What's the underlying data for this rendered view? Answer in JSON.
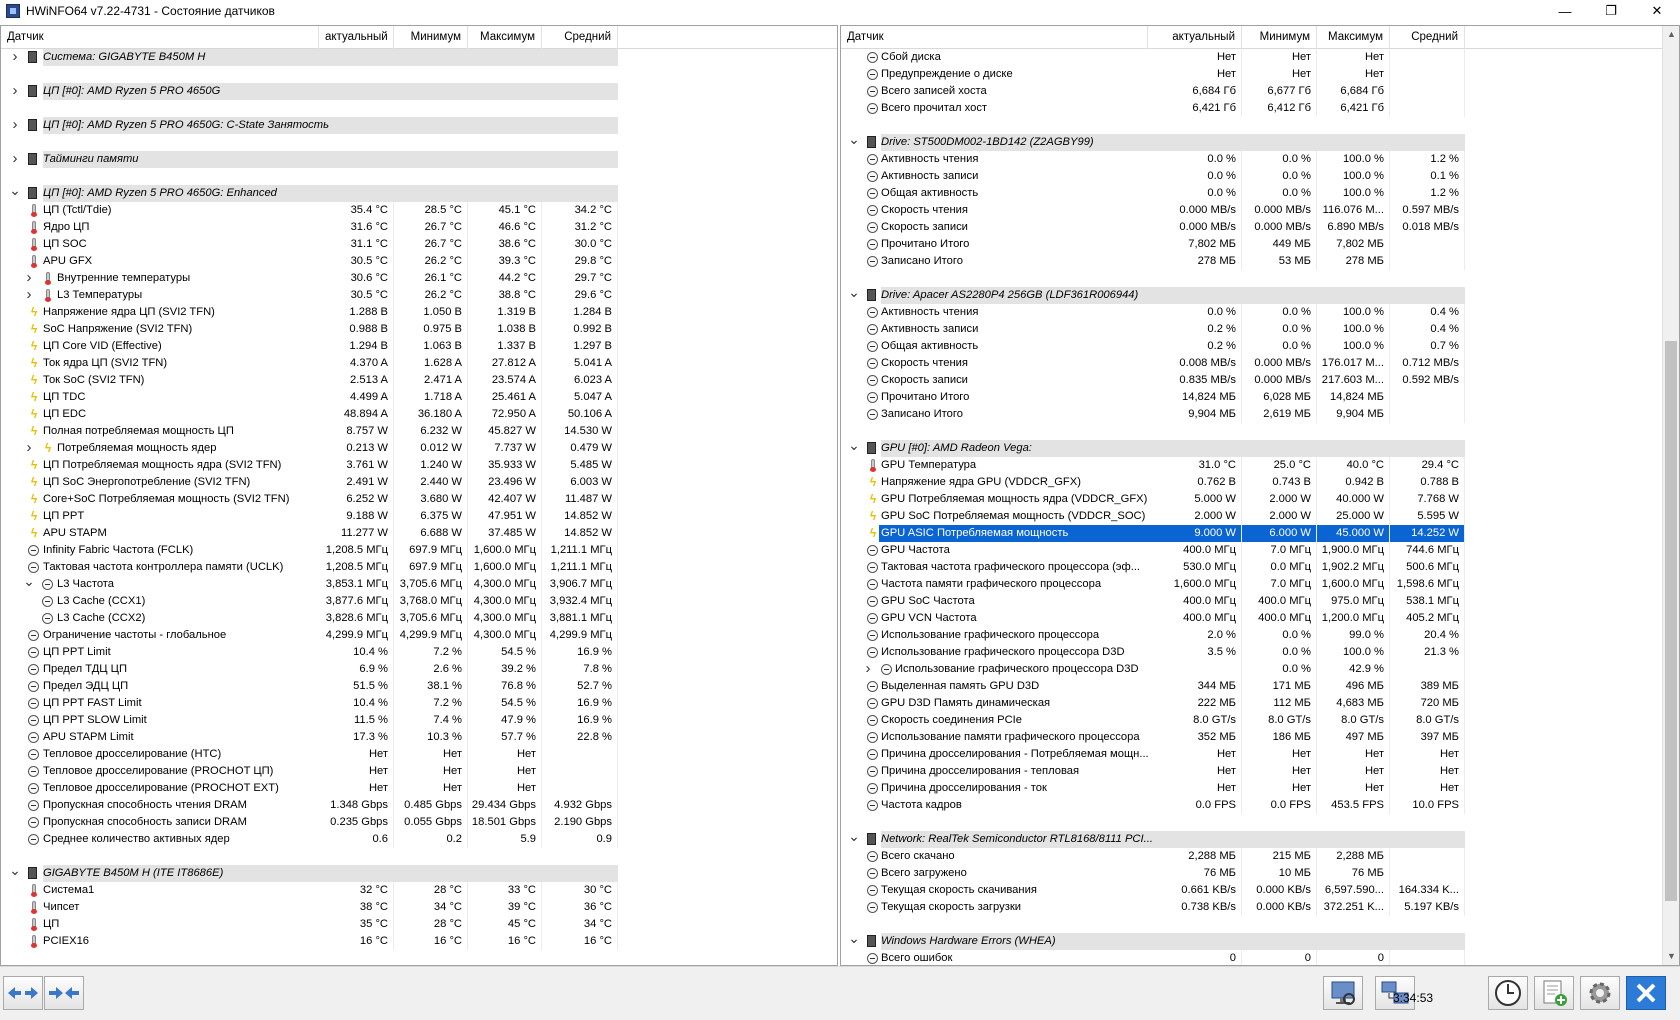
{
  "window": {
    "title": "HWiNFO64 v7.22-4731 - Состояние датчиков",
    "minimize": "—",
    "maximize": "❐",
    "close": "✕"
  },
  "headers": {
    "sensor": "Датчик",
    "current": "актуальный",
    "min": "Минимум",
    "max": "Максимум",
    "avg": "Средний"
  },
  "left_rows": [
    {
      "t": "group",
      "exp": ">",
      "icon": "chip",
      "name": "Система: GIGABYTE B450M H"
    },
    {
      "t": "blank"
    },
    {
      "t": "group",
      "exp": ">",
      "icon": "chip",
      "name": "ЦП [#0]: AMD Ryzen 5 PRO 4650G"
    },
    {
      "t": "blank"
    },
    {
      "t": "group",
      "exp": ">",
      "icon": "chip",
      "name": "ЦП [#0]: AMD Ryzen 5 PRO 4650G: C-State Занятость"
    },
    {
      "t": "blank"
    },
    {
      "t": "group",
      "exp": ">",
      "icon": "chip",
      "name": "Тайминги памяти"
    },
    {
      "t": "blank"
    },
    {
      "t": "group",
      "exp": "v",
      "icon": "chip",
      "name": "ЦП [#0]: AMD Ryzen 5 PRO 4650G: Enhanced"
    },
    {
      "icon": "therm",
      "name": "ЦП (Tctl/Tdie)",
      "v": [
        "35.4 °C",
        "28.5 °C",
        "45.1 °C",
        "34.2 °C"
      ]
    },
    {
      "icon": "therm",
      "name": "Ядро ЦП",
      "v": [
        "31.6 °C",
        "26.7 °C",
        "46.6 °C",
        "31.2 °C"
      ]
    },
    {
      "icon": "therm",
      "name": "ЦП SOC",
      "v": [
        "31.1 °C",
        "26.7 °C",
        "38.6 °C",
        "30.0 °C"
      ]
    },
    {
      "icon": "therm",
      "name": "APU GFX",
      "v": [
        "30.5 °C",
        "26.2 °C",
        "39.3 °C",
        "29.8 °C"
      ]
    },
    {
      "icon": "therm",
      "sub": 1,
      "exp": ">",
      "name": "Внутренние температуры",
      "v": [
        "30.6 °C",
        "26.1 °C",
        "44.2 °C",
        "29.7 °C"
      ]
    },
    {
      "icon": "therm",
      "sub": 1,
      "exp": ">",
      "name": "L3 Температуры",
      "v": [
        "30.5 °C",
        "26.2 °C",
        "38.8 °C",
        "29.6 °C"
      ]
    },
    {
      "icon": "bolt",
      "name": "Напряжение ядра ЦП (SVI2 TFN)",
      "v": [
        "1.288 В",
        "1.050 В",
        "1.319 В",
        "1.284 В"
      ]
    },
    {
      "icon": "bolt",
      "name": "SoC Напряжение (SVI2 TFN)",
      "v": [
        "0.988 В",
        "0.975 В",
        "1.038 В",
        "0.992 В"
      ]
    },
    {
      "icon": "bolt",
      "name": "ЦП Core VID (Effective)",
      "v": [
        "1.294 В",
        "1.063 В",
        "1.337 В",
        "1.297 В"
      ]
    },
    {
      "icon": "bolt",
      "name": "Ток ядра ЦП (SVI2 TFN)",
      "v": [
        "4.370 A",
        "1.628 A",
        "27.812 A",
        "5.041 A"
      ]
    },
    {
      "icon": "bolt",
      "name": "Ток SoC (SVI2 TFN)",
      "v": [
        "2.513 A",
        "2.471 A",
        "23.574 A",
        "6.023 A"
      ]
    },
    {
      "icon": "bolt",
      "name": "ЦП TDC",
      "v": [
        "4.499 A",
        "1.718 A",
        "25.461 A",
        "5.047 A"
      ]
    },
    {
      "icon": "bolt",
      "name": "ЦП EDC",
      "v": [
        "48.894 A",
        "36.180 A",
        "72.950 A",
        "50.106 A"
      ]
    },
    {
      "icon": "bolt",
      "name": "Полная потребляемая мощность ЦП",
      "v": [
        "8.757 W",
        "6.232 W",
        "45.827 W",
        "14.530 W"
      ]
    },
    {
      "icon": "bolt",
      "sub": 1,
      "exp": ">",
      "name": "Потребляемая мощность ядер",
      "v": [
        "0.213 W",
        "0.012 W",
        "7.737 W",
        "0.479 W"
      ]
    },
    {
      "icon": "bolt",
      "name": "ЦП Потребляемая мощность ядра (SVI2 TFN)",
      "v": [
        "3.761 W",
        "1.240 W",
        "35.933 W",
        "5.485 W"
      ]
    },
    {
      "icon": "bolt",
      "name": "ЦП SoC Энергопотребление (SVI2 TFN)",
      "v": [
        "2.491 W",
        "2.440 W",
        "23.496 W",
        "6.003 W"
      ]
    },
    {
      "icon": "bolt",
      "name": "Core+SoC Потребляемая мощность (SVI2 TFN)",
      "v": [
        "6.252 W",
        "3.680 W",
        "42.407 W",
        "11.487 W"
      ]
    },
    {
      "icon": "bolt",
      "name": "ЦП PPT",
      "v": [
        "9.188 W",
        "6.375 W",
        "47.951 W",
        "14.852 W"
      ]
    },
    {
      "icon": "bolt",
      "name": "APU STAPM",
      "v": [
        "11.277 W",
        "6.688 W",
        "37.485 W",
        "14.852 W"
      ]
    },
    {
      "icon": "clock",
      "name": "Infinity Fabric Частота (FCLK)",
      "v": [
        "1,208.5 МГц",
        "697.9 МГц",
        "1,600.0 МГц",
        "1,211.1 МГц"
      ]
    },
    {
      "icon": "clock",
      "name": "Тактовая частота контроллера памяти (UCLK)",
      "v": [
        "1,208.5 МГц",
        "697.9 МГц",
        "1,600.0 МГц",
        "1,211.1 МГц"
      ]
    },
    {
      "icon": "clock",
      "sub": 1,
      "exp": "v",
      "name": "L3 Частота",
      "v": [
        "3,853.1 МГц",
        "3,705.6 МГц",
        "4,300.0 МГц",
        "3,906.7 МГц"
      ]
    },
    {
      "icon": "clock",
      "sub": 1,
      "name": "L3 Cache (CCX1)",
      "v": [
        "3,877.6 МГц",
        "3,768.0 МГц",
        "4,300.0 МГц",
        "3,932.4 МГц"
      ]
    },
    {
      "icon": "clock",
      "sub": 1,
      "name": "L3 Cache (CCX2)",
      "v": [
        "3,828.6 МГц",
        "3,705.6 МГц",
        "4,300.0 МГц",
        "3,881.1 МГц"
      ]
    },
    {
      "icon": "clock",
      "name": "Ограничение частоты - глобальное",
      "v": [
        "4,299.9 МГц",
        "4,299.9 МГц",
        "4,300.0 МГц",
        "4,299.9 МГц"
      ]
    },
    {
      "icon": "clock",
      "name": "ЦП PPT Limit",
      "v": [
        "10.4 %",
        "7.2 %",
        "54.5 %",
        "16.9 %"
      ]
    },
    {
      "icon": "clock",
      "name": "Предел ТДЦ ЦП",
      "v": [
        "6.9 %",
        "2.6 %",
        "39.2 %",
        "7.8 %"
      ]
    },
    {
      "icon": "clock",
      "name": "Предел ЭДЦ ЦП",
      "v": [
        "51.5 %",
        "38.1 %",
        "76.8 %",
        "52.7 %"
      ]
    },
    {
      "icon": "clock",
      "name": "ЦП PPT FAST Limit",
      "v": [
        "10.4 %",
        "7.2 %",
        "54.5 %",
        "16.9 %"
      ]
    },
    {
      "icon": "clock",
      "name": "ЦП PPT SLOW Limit",
      "v": [
        "11.5 %",
        "7.4 %",
        "47.9 %",
        "16.9 %"
      ]
    },
    {
      "icon": "clock",
      "name": "APU STAPM Limit",
      "v": [
        "17.3 %",
        "10.3 %",
        "57.7 %",
        "22.8 %"
      ]
    },
    {
      "icon": "clock",
      "name": "Тепловое дросселирование (HTC)",
      "v": [
        "Нет",
        "Нет",
        "Нет",
        ""
      ]
    },
    {
      "icon": "clock",
      "name": "Тепловое дросселирование (PROCHOT ЦП)",
      "v": [
        "Нет",
        "Нет",
        "Нет",
        ""
      ]
    },
    {
      "icon": "clock",
      "name": "Тепловое дросселирование (PROCHOT EXT)",
      "v": [
        "Нет",
        "Нет",
        "Нет",
        ""
      ]
    },
    {
      "icon": "clock",
      "name": "Пропускная способность чтения DRAM",
      "v": [
        "1.348 Gbps",
        "0.485 Gbps",
        "29.434 Gbps",
        "4.932 Gbps"
      ]
    },
    {
      "icon": "clock",
      "name": "Пропускная способность записи DRAM",
      "v": [
        "0.235 Gbps",
        "0.055 Gbps",
        "18.501 Gbps",
        "2.190 Gbps"
      ]
    },
    {
      "icon": "clock",
      "name": "Среднее количество активных ядер",
      "v": [
        "0.6",
        "0.2",
        "5.9",
        "0.9"
      ]
    },
    {
      "t": "blank"
    },
    {
      "t": "group",
      "exp": "v",
      "icon": "chip",
      "name": "GIGABYTE B450M H (ITE IT8686E)"
    },
    {
      "icon": "therm",
      "name": "Система1",
      "v": [
        "32 °C",
        "28 °C",
        "33 °C",
        "30 °C"
      ]
    },
    {
      "icon": "therm",
      "name": "Чипсет",
      "v": [
        "38 °C",
        "34 °C",
        "39 °C",
        "36 °C"
      ]
    },
    {
      "icon": "therm",
      "name": "ЦП",
      "v": [
        "35 °C",
        "28 °C",
        "45 °C",
        "34 °C"
      ]
    },
    {
      "icon": "therm",
      "name": "PCIEX16",
      "v": [
        "16 °C",
        "16 °C",
        "16 °C",
        "16 °C"
      ]
    }
  ],
  "right_rows": [
    {
      "icon": "clock",
      "name": "Сбой диска",
      "v": [
        "Нет",
        "Нет",
        "Нет",
        ""
      ]
    },
    {
      "icon": "clock",
      "name": "Предупреждение о диске",
      "v": [
        "Нет",
        "Нет",
        "Нет",
        ""
      ]
    },
    {
      "icon": "clock",
      "name": "Всего записей хоста",
      "v": [
        "6,684 Гб",
        "6,677 Гб",
        "6,684 Гб",
        ""
      ]
    },
    {
      "icon": "clock",
      "name": "Всего прочитал хост",
      "v": [
        "6,421 Гб",
        "6,412 Гб",
        "6,421 Гб",
        ""
      ]
    },
    {
      "t": "blank"
    },
    {
      "t": "group",
      "exp": "v",
      "icon": "chip",
      "name": "Drive: ST500DM002-1BD142 (Z2AGBY99)"
    },
    {
      "icon": "clock",
      "name": "Активность чтения",
      "v": [
        "0.0 %",
        "0.0 %",
        "100.0 %",
        "1.2 %"
      ]
    },
    {
      "icon": "clock",
      "name": "Активность записи",
      "v": [
        "0.0 %",
        "0.0 %",
        "100.0 %",
        "0.1 %"
      ]
    },
    {
      "icon": "clock",
      "name": "Общая активность",
      "v": [
        "0.0 %",
        "0.0 %",
        "100.0 %",
        "1.2 %"
      ]
    },
    {
      "icon": "clock",
      "name": "Скорость чтения",
      "v": [
        "0.000 MB/s",
        "0.000 MB/s",
        "116.076 M...",
        "0.597 MB/s"
      ]
    },
    {
      "icon": "clock",
      "name": "Скорость записи",
      "v": [
        "0.000 MB/s",
        "0.000 MB/s",
        "6.890 MB/s",
        "0.018 MB/s"
      ]
    },
    {
      "icon": "clock",
      "name": "Прочитано Итого",
      "v": [
        "7,802 МБ",
        "449 МБ",
        "7,802 МБ",
        ""
      ]
    },
    {
      "icon": "clock",
      "name": "Записано Итого",
      "v": [
        "278 МБ",
        "53 МБ",
        "278 МБ",
        ""
      ]
    },
    {
      "t": "blank"
    },
    {
      "t": "group",
      "exp": "v",
      "icon": "chip",
      "name": "Drive: Apacer AS2280P4 256GB (LDF361R006944)"
    },
    {
      "icon": "clock",
      "name": "Активность чтения",
      "v": [
        "0.0 %",
        "0.0 %",
        "100.0 %",
        "0.4 %"
      ]
    },
    {
      "icon": "clock",
      "name": "Активность записи",
      "v": [
        "0.2 %",
        "0.0 %",
        "100.0 %",
        "0.4 %"
      ]
    },
    {
      "icon": "clock",
      "name": "Общая активность",
      "v": [
        "0.2 %",
        "0.0 %",
        "100.0 %",
        "0.7 %"
      ]
    },
    {
      "icon": "clock",
      "name": "Скорость чтения",
      "v": [
        "0.008 MB/s",
        "0.000 MB/s",
        "176.017 M...",
        "0.712 MB/s"
      ]
    },
    {
      "icon": "clock",
      "name": "Скорость записи",
      "v": [
        "0.835 MB/s",
        "0.000 MB/s",
        "217.603 M...",
        "0.592 MB/s"
      ]
    },
    {
      "icon": "clock",
      "name": "Прочитано Итого",
      "v": [
        "14,824 МБ",
        "6,028 МБ",
        "14,824 МБ",
        ""
      ]
    },
    {
      "icon": "clock",
      "name": "Записано Итого",
      "v": [
        "9,904 МБ",
        "2,619 МБ",
        "9,904 МБ",
        ""
      ]
    },
    {
      "t": "blank"
    },
    {
      "t": "group",
      "exp": "v",
      "icon": "chip",
      "name": "GPU [#0]: AMD Radeon Vega:"
    },
    {
      "icon": "therm",
      "name": "GPU Температура",
      "v": [
        "31.0 °C",
        "25.0 °C",
        "40.0 °C",
        "29.4 °C"
      ]
    },
    {
      "icon": "bolt",
      "name": "Напряжение ядра GPU (VDDCR_GFX)",
      "v": [
        "0.762 В",
        "0.743 В",
        "0.942 В",
        "0.788 В"
      ]
    },
    {
      "icon": "bolt",
      "name": "GPU Потребляемая мощность ядра (VDDCR_GFX)",
      "v": [
        "5.000 W",
        "2.000 W",
        "40.000 W",
        "7.768 W"
      ]
    },
    {
      "icon": "bolt",
      "name": "GPU SoC Потребляемая мощность (VDDCR_SOC)",
      "v": [
        "2.000 W",
        "2.000 W",
        "25.000 W",
        "5.595 W"
      ]
    },
    {
      "icon": "bolt",
      "sel": true,
      "name": "GPU ASIC Потребляемая мощность",
      "v": [
        "9.000 W",
        "6.000 W",
        "45.000 W",
        "14.252 W"
      ]
    },
    {
      "icon": "clock",
      "name": "GPU Частота",
      "v": [
        "400.0 МГц",
        "7.0 МГц",
        "1,900.0 МГц",
        "744.6 МГц"
      ]
    },
    {
      "icon": "clock",
      "name": "Тактовая частота графического процессора (эф...",
      "v": [
        "530.0 МГц",
        "0.0 МГц",
        "1,902.2 МГц",
        "500.6 МГц"
      ]
    },
    {
      "icon": "clock",
      "name": "Частота памяти графического процессора",
      "v": [
        "1,600.0 МГц",
        "7.0 МГц",
        "1,600.0 МГц",
        "1,598.6 МГц"
      ]
    },
    {
      "icon": "clock",
      "name": "GPU SoC Частота",
      "v": [
        "400.0 МГц",
        "400.0 МГц",
        "975.0 МГц",
        "538.1 МГц"
      ]
    },
    {
      "icon": "clock",
      "name": "GPU VCN Частота",
      "v": [
        "400.0 МГц",
        "400.0 МГц",
        "1,200.0 МГц",
        "405.2 МГц"
      ]
    },
    {
      "icon": "clock",
      "name": "Использование графического процессора",
      "v": [
        "2.0 %",
        "0.0 %",
        "99.0 %",
        "20.4 %"
      ]
    },
    {
      "icon": "clock",
      "name": "Использование графического процессора D3D",
      "v": [
        "3.5 %",
        "0.0 %",
        "100.0 %",
        "21.3 %"
      ]
    },
    {
      "icon": "clock",
      "sub": 1,
      "exp": ">",
      "name": "Использование графического процессора D3D",
      "v": [
        "",
        "0.0 %",
        "42.9 %",
        ""
      ]
    },
    {
      "icon": "clock",
      "name": "Выделенная память GPU D3D",
      "v": [
        "344 МБ",
        "171 МБ",
        "496 МБ",
        "389 МБ"
      ]
    },
    {
      "icon": "clock",
      "name": "GPU D3D Память динамическая",
      "v": [
        "222 МБ",
        "112 МБ",
        "4,683 МБ",
        "720 МБ"
      ]
    },
    {
      "icon": "clock",
      "name": "Скорость соединения PCIe",
      "v": [
        "8.0 GT/s",
        "8.0 GT/s",
        "8.0 GT/s",
        "8.0 GT/s"
      ]
    },
    {
      "icon": "clock",
      "name": "Использование памяти графического процессора",
      "v": [
        "352 МБ",
        "186 МБ",
        "497 МБ",
        "397 МБ"
      ]
    },
    {
      "icon": "clock",
      "name": "Причина дросселирования - Потребляемая мощн...",
      "v": [
        "Нет",
        "Нет",
        "Нет",
        "Нет"
      ]
    },
    {
      "icon": "clock",
      "name": "Причина дросселирования - тепловая",
      "v": [
        "Нет",
        "Нет",
        "Нет",
        "Нет"
      ]
    },
    {
      "icon": "clock",
      "name": "Причина дросселирования - ток",
      "v": [
        "Нет",
        "Нет",
        "Нет",
        "Нет"
      ]
    },
    {
      "icon": "clock",
      "name": "Частота кадров",
      "v": [
        "0.0 FPS",
        "0.0 FPS",
        "453.5 FPS",
        "10.0 FPS"
      ]
    },
    {
      "t": "blank"
    },
    {
      "t": "group",
      "exp": "v",
      "icon": "chip",
      "name": "Network: RealTek Semiconductor RTL8168/8111 PCI..."
    },
    {
      "icon": "clock",
      "name": "Всего скачано",
      "v": [
        "2,288 МБ",
        "215 МБ",
        "2,288 МБ",
        ""
      ]
    },
    {
      "icon": "clock",
      "name": "Всего загружено",
      "v": [
        "76 МБ",
        "10 МБ",
        "76 МБ",
        ""
      ]
    },
    {
      "icon": "clock",
      "name": "Текущая скорость скачивания",
      "v": [
        "0.661 KB/s",
        "0.000 KB/s",
        "6,597.590...",
        "164.334 K..."
      ]
    },
    {
      "icon": "clock",
      "name": "Текущая скорость загрузки",
      "v": [
        "0.738 KB/s",
        "0.000 KB/s",
        "372.251 K...",
        "5.197 KB/s"
      ]
    },
    {
      "t": "blank"
    },
    {
      "t": "group",
      "exp": "v",
      "icon": "chip",
      "name": "Windows Hardware Errors (WHEA)"
    },
    {
      "icon": "clock",
      "name": "Всего ошибок",
      "v": [
        "0",
        "0",
        "0",
        ""
      ]
    }
  ],
  "statusbar": {
    "time": "3:34:53"
  }
}
